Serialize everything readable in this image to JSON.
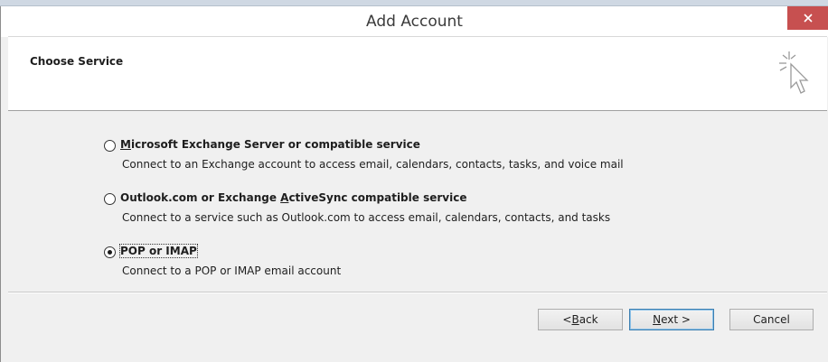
{
  "window": {
    "title": "Add Account",
    "close_icon": "close-icon"
  },
  "header": {
    "title": "Choose Service",
    "art_icon": "cursor-sparkle-icon"
  },
  "options": [
    {
      "label_accel": "M",
      "label_rest": "icrosoft Exchange Server or compatible service",
      "description": "Connect to an Exchange account to access email, calendars, contacts, tasks, and voice mail",
      "selected": false
    },
    {
      "label_pre": "Outlook.com or Exchange ",
      "label_accel": "A",
      "label_rest": "ctiveSync compatible service",
      "description": "Connect to a service such as Outlook.com to access email, calendars, contacts, and tasks",
      "selected": false
    },
    {
      "label": "POP or IMAP",
      "description": "Connect to a POP or IMAP email account",
      "selected": true
    }
  ],
  "buttons": {
    "back_pre": "< ",
    "back_accel": "B",
    "back_rest": "ack",
    "next_accel": "N",
    "next_rest": "ext >",
    "cancel": "Cancel"
  },
  "colors": {
    "close_button": "#c75050",
    "default_button_border": "#3c7fb1"
  }
}
